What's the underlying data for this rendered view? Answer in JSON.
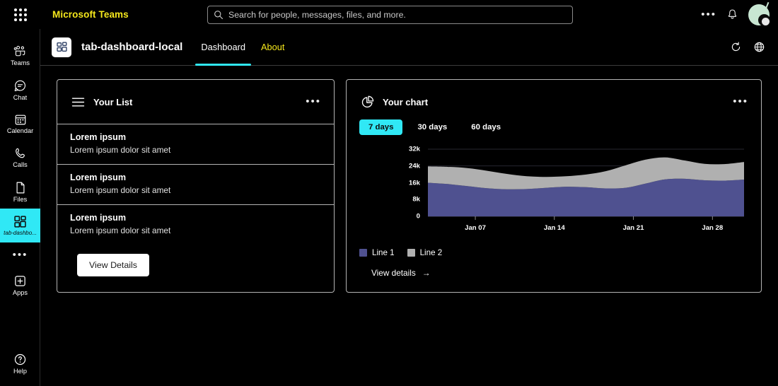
{
  "topbar": {
    "waffle_icon": "app-launcher-grid-icon",
    "brand": "Microsoft Teams",
    "search": {
      "icon": "search-icon",
      "placeholder": "Search for people, messages, files, and more.",
      "value": ""
    },
    "more_label": "•••",
    "bell_icon": "bell-icon",
    "avatar_icon": "user-avatar"
  },
  "rail": {
    "items": [
      {
        "label": "Teams",
        "icon": "teams-icon",
        "active": false
      },
      {
        "label": "Chat",
        "icon": "chat-icon",
        "active": false
      },
      {
        "label": "Calendar",
        "icon": "calendar-icon",
        "active": false
      },
      {
        "label": "Calls",
        "icon": "calls-icon",
        "active": false
      },
      {
        "label": "Files",
        "icon": "files-icon",
        "active": false
      },
      {
        "label": "tab-dashbo...",
        "icon": "dashboard-icon",
        "active": true
      }
    ],
    "more_label": "•••",
    "apps": {
      "label": "Apps",
      "icon": "apps-plus-icon"
    },
    "help": {
      "label": "Help",
      "icon": "help-question-icon"
    },
    "active_color": "#30e8f5"
  },
  "app_header": {
    "icon": "dashboard-app-icon",
    "title": "tab-dashboard-local",
    "tabs": [
      {
        "label": "Dashboard",
        "active": true
      },
      {
        "label": "About",
        "active": false
      }
    ],
    "refresh_icon": "refresh-icon",
    "globe_icon": "globe-icon",
    "active_tab_color": "#30e8f5",
    "inactive_tab_color": "#f5e71c"
  },
  "list_card": {
    "icon": "list-lines-icon",
    "title": "Your List",
    "menu_label": "•••",
    "items": [
      {
        "title": "Lorem ipsum",
        "subtitle": "Lorem ipsum dolor sit amet"
      },
      {
        "title": "Lorem ipsum",
        "subtitle": "Lorem ipsum dolor sit amet"
      },
      {
        "title": "Lorem ipsum",
        "subtitle": "Lorem ipsum dolor sit amet"
      }
    ],
    "button_label": "View Details"
  },
  "chart_card": {
    "icon": "pie-chart-icon",
    "title": "Your chart",
    "menu_label": "•••",
    "range_tabs": [
      {
        "label": "7 days",
        "active": true
      },
      {
        "label": "30 days",
        "active": false
      },
      {
        "label": "60 days",
        "active": false
      }
    ],
    "view_details_label": "View details",
    "view_details_arrow": "→"
  },
  "chart_data": {
    "type": "area",
    "stacked": true,
    "title": "Your chart",
    "xlabel": "",
    "ylabel": "",
    "grid": true,
    "legend_position": "bottom-left",
    "ylim": [
      0,
      32000
    ],
    "ytick_labels": [
      "32k",
      "24k",
      "16k",
      "8k",
      "0"
    ],
    "yticks": [
      32000,
      24000,
      16000,
      8000,
      0
    ],
    "xtick_labels": [
      "Jan 07",
      "Jan 14",
      "Jan 21",
      "Jan 28"
    ],
    "x": [
      0,
      1,
      2,
      3,
      4,
      5,
      6,
      7,
      8,
      9,
      10,
      11,
      12,
      13,
      14,
      15,
      16
    ],
    "series": [
      {
        "name": "Line 1",
        "color": "#4f5190",
        "values": [
          16000,
          15400,
          14400,
          13400,
          12900,
          13000,
          13600,
          14100,
          13900,
          13300,
          13600,
          15600,
          17600,
          17900,
          17200,
          17000,
          17500
        ]
      },
      {
        "name": "Line 2",
        "color": "#b0b0b0",
        "values": [
          7800,
          8200,
          8600,
          8300,
          7300,
          6100,
          5200,
          5000,
          6000,
          8200,
          10700,
          11400,
          10500,
          8700,
          7800,
          7900,
          8400
        ]
      }
    ]
  }
}
